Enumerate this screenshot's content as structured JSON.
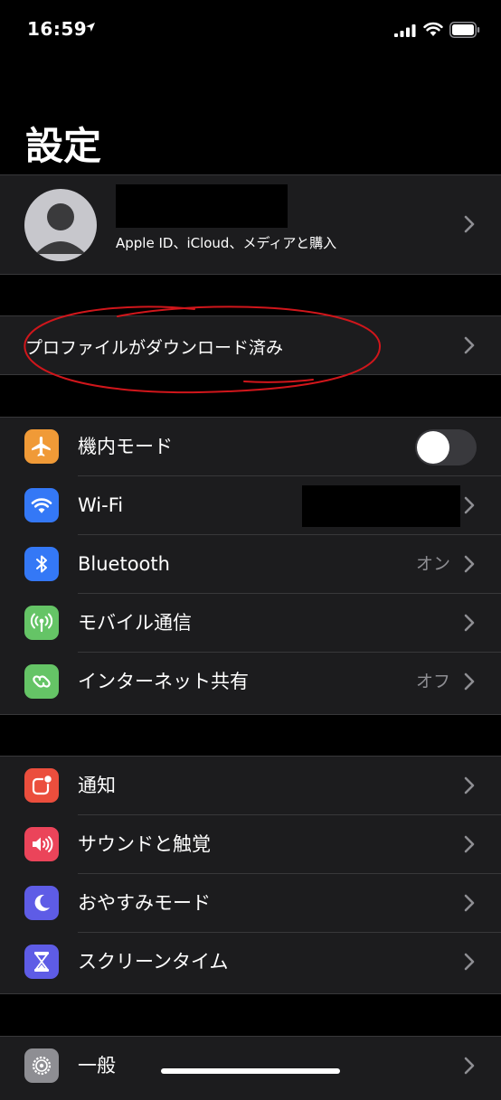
{
  "status_bar": {
    "time": "16:59"
  },
  "header": {
    "title": "設定"
  },
  "profile": {
    "subtitle": "Apple ID、iCloud、メディアと購入"
  },
  "profile_downloaded": {
    "label": "プロファイルがダウンロード済み"
  },
  "group1": {
    "airplane": {
      "label": "機内モード",
      "toggle_on": false,
      "icon": "airplane-icon",
      "color": "#f09a37"
    },
    "wifi": {
      "label": "Wi-Fi",
      "icon": "wifi-icon",
      "color": "#3478f6"
    },
    "bluetooth": {
      "label": "Bluetooth",
      "value": "オン",
      "icon": "bluetooth-icon",
      "color": "#3478f6"
    },
    "cellular": {
      "label": "モバイル通信",
      "icon": "antenna-icon",
      "color": "#65c466"
    },
    "hotspot": {
      "label": "インターネット共有",
      "value": "オフ",
      "icon": "link-icon",
      "color": "#65c466"
    }
  },
  "group2": {
    "notifications": {
      "label": "通知",
      "icon": "notification-icon",
      "color": "#eb4e3d"
    },
    "sounds": {
      "label": "サウンドと触覚",
      "icon": "speaker-icon",
      "color": "#eb445a"
    },
    "dnd": {
      "label": "おやすみモード",
      "icon": "moon-icon",
      "color": "#5e5ce6"
    },
    "screentime": {
      "label": "スクリーンタイム",
      "icon": "hourglass-icon",
      "color": "#5e5ce6"
    }
  },
  "group3": {
    "general": {
      "label": "一般",
      "icon": "gear-icon",
      "color": "#8e8e93"
    }
  }
}
